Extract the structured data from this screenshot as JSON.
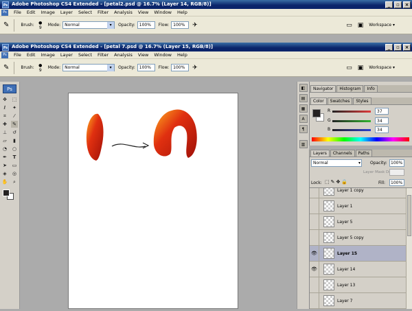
{
  "win1": {
    "title": "Adobe Photoshop CS4 Extended - [petal2.psd @ 16.7% (Layer 14, RGB/8)]",
    "buttons": [
      "_",
      "▫",
      "×"
    ]
  },
  "win2": {
    "title": "Adobe Photoshop CS4 Extended - [petal 7.psd @ 16.7% (Layer 15, RGB/8)]",
    "buttons": [
      "_",
      "▫",
      "×"
    ]
  },
  "logo": "Ps",
  "menu": [
    "File",
    "Edit",
    "Image",
    "Layer",
    "Select",
    "Filter",
    "Analysis",
    "View",
    "Window",
    "Help"
  ],
  "options": {
    "brush_label": "Brush:",
    "brush_size": "9",
    "mode_label": "Mode:",
    "mode_value": "Normal",
    "opacity_label": "Opacity:",
    "opacity_value": "100%",
    "flow_label": "Flow:",
    "flow_value": "100%",
    "workspace_label": "Workspace ▾"
  },
  "navigator": {
    "tabs": [
      "Navigator",
      "Histogram",
      "Info"
    ]
  },
  "color_panel": {
    "tabs": [
      "Color",
      "Swatches",
      "Styles"
    ],
    "channels": [
      {
        "label": "R",
        "value": "37",
        "color": "#e03a3a"
      },
      {
        "label": "G",
        "value": "34",
        "color": "#2fb52f"
      },
      {
        "label": "B",
        "value": "34",
        "color": "#2a3fd0"
      }
    ],
    "foreground": "#252222",
    "background": "#ffffff"
  },
  "layers_panel": {
    "tabs": [
      "Layers",
      "Channels",
      "Paths"
    ],
    "blend_mode": "Normal",
    "opacity_label": "Opacity:",
    "opacity_value": "100%",
    "density_label": "Layer Mask Density:",
    "lock_label": "Lock:",
    "fill_label": "Fill:",
    "fill_value": "100%",
    "layers": [
      {
        "name": "Layer 1 copy",
        "visible": false,
        "selected": false
      },
      {
        "name": "Layer 1",
        "visible": false,
        "selected": false
      },
      {
        "name": "Layer 5",
        "visible": false,
        "selected": false
      },
      {
        "name": "Layer 5 copy",
        "visible": false,
        "selected": false
      },
      {
        "name": "Layer 15",
        "visible": true,
        "selected": true
      },
      {
        "name": "Layer 14",
        "visible": true,
        "selected": false
      },
      {
        "name": "Layer 13",
        "visible": false,
        "selected": false
      },
      {
        "name": "Layer 7",
        "visible": false,
        "selected": false
      }
    ]
  },
  "accent": "#0a246a"
}
